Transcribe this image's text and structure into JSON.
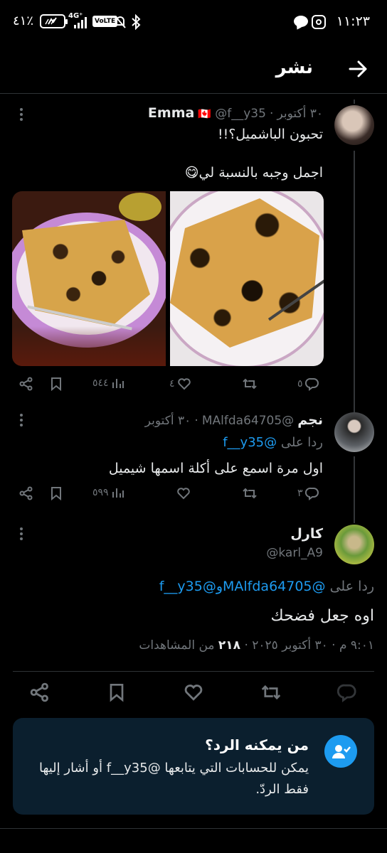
{
  "status_bar": {
    "time": "١١:٢٣",
    "battery_pct": "٤١٪",
    "network": "4G⁺",
    "volte": "VoLTE"
  },
  "header": {
    "title": "نشر"
  },
  "tweets": [
    {
      "name": "Emma",
      "flag": "🇨🇦",
      "handle": "@f__y35",
      "date": "٣٠ أكتوبر",
      "text_line1": "تحبون الباشميل؟!!",
      "text_line2": "اجمل وجبه بالنسبة لي😋",
      "views": "٥٤٤",
      "likes": "٤",
      "replies": "٥"
    },
    {
      "name": "نجم",
      "handle": "@MAlfda64705",
      "date": "٣٠ أكتوبر",
      "reply_prefix": "ردا على",
      "reply_to": "@f__y35",
      "text": "اول مرة اسمع على أكلة اسمها شيميل",
      "views": "٥٩٩",
      "replies": "٣"
    }
  ],
  "main_tweet": {
    "name": "كارل",
    "handle": "@karl_A9",
    "reply_prefix": "ردا على",
    "reply_to_1": "@MAlfda64705",
    "reply_joiner": "و",
    "reply_to_2": "@f__y35",
    "text": "اوه جعل فضحك",
    "timestamp": "٩:٠١ م · ٣٠ أكتوبر ٢٠٢٥ · ",
    "views_count": "٢١٨",
    "views_label": "من المشاهدات"
  },
  "who_can_reply": {
    "title": "من يمكنه الرد؟",
    "text": "يمكن للحسابات التي يتابعها @f__y35 أو أشار إليها فقط الردّ."
  },
  "colors": {
    "accent": "#1d9bf0",
    "muted": "#71767b",
    "background": "#000000"
  }
}
